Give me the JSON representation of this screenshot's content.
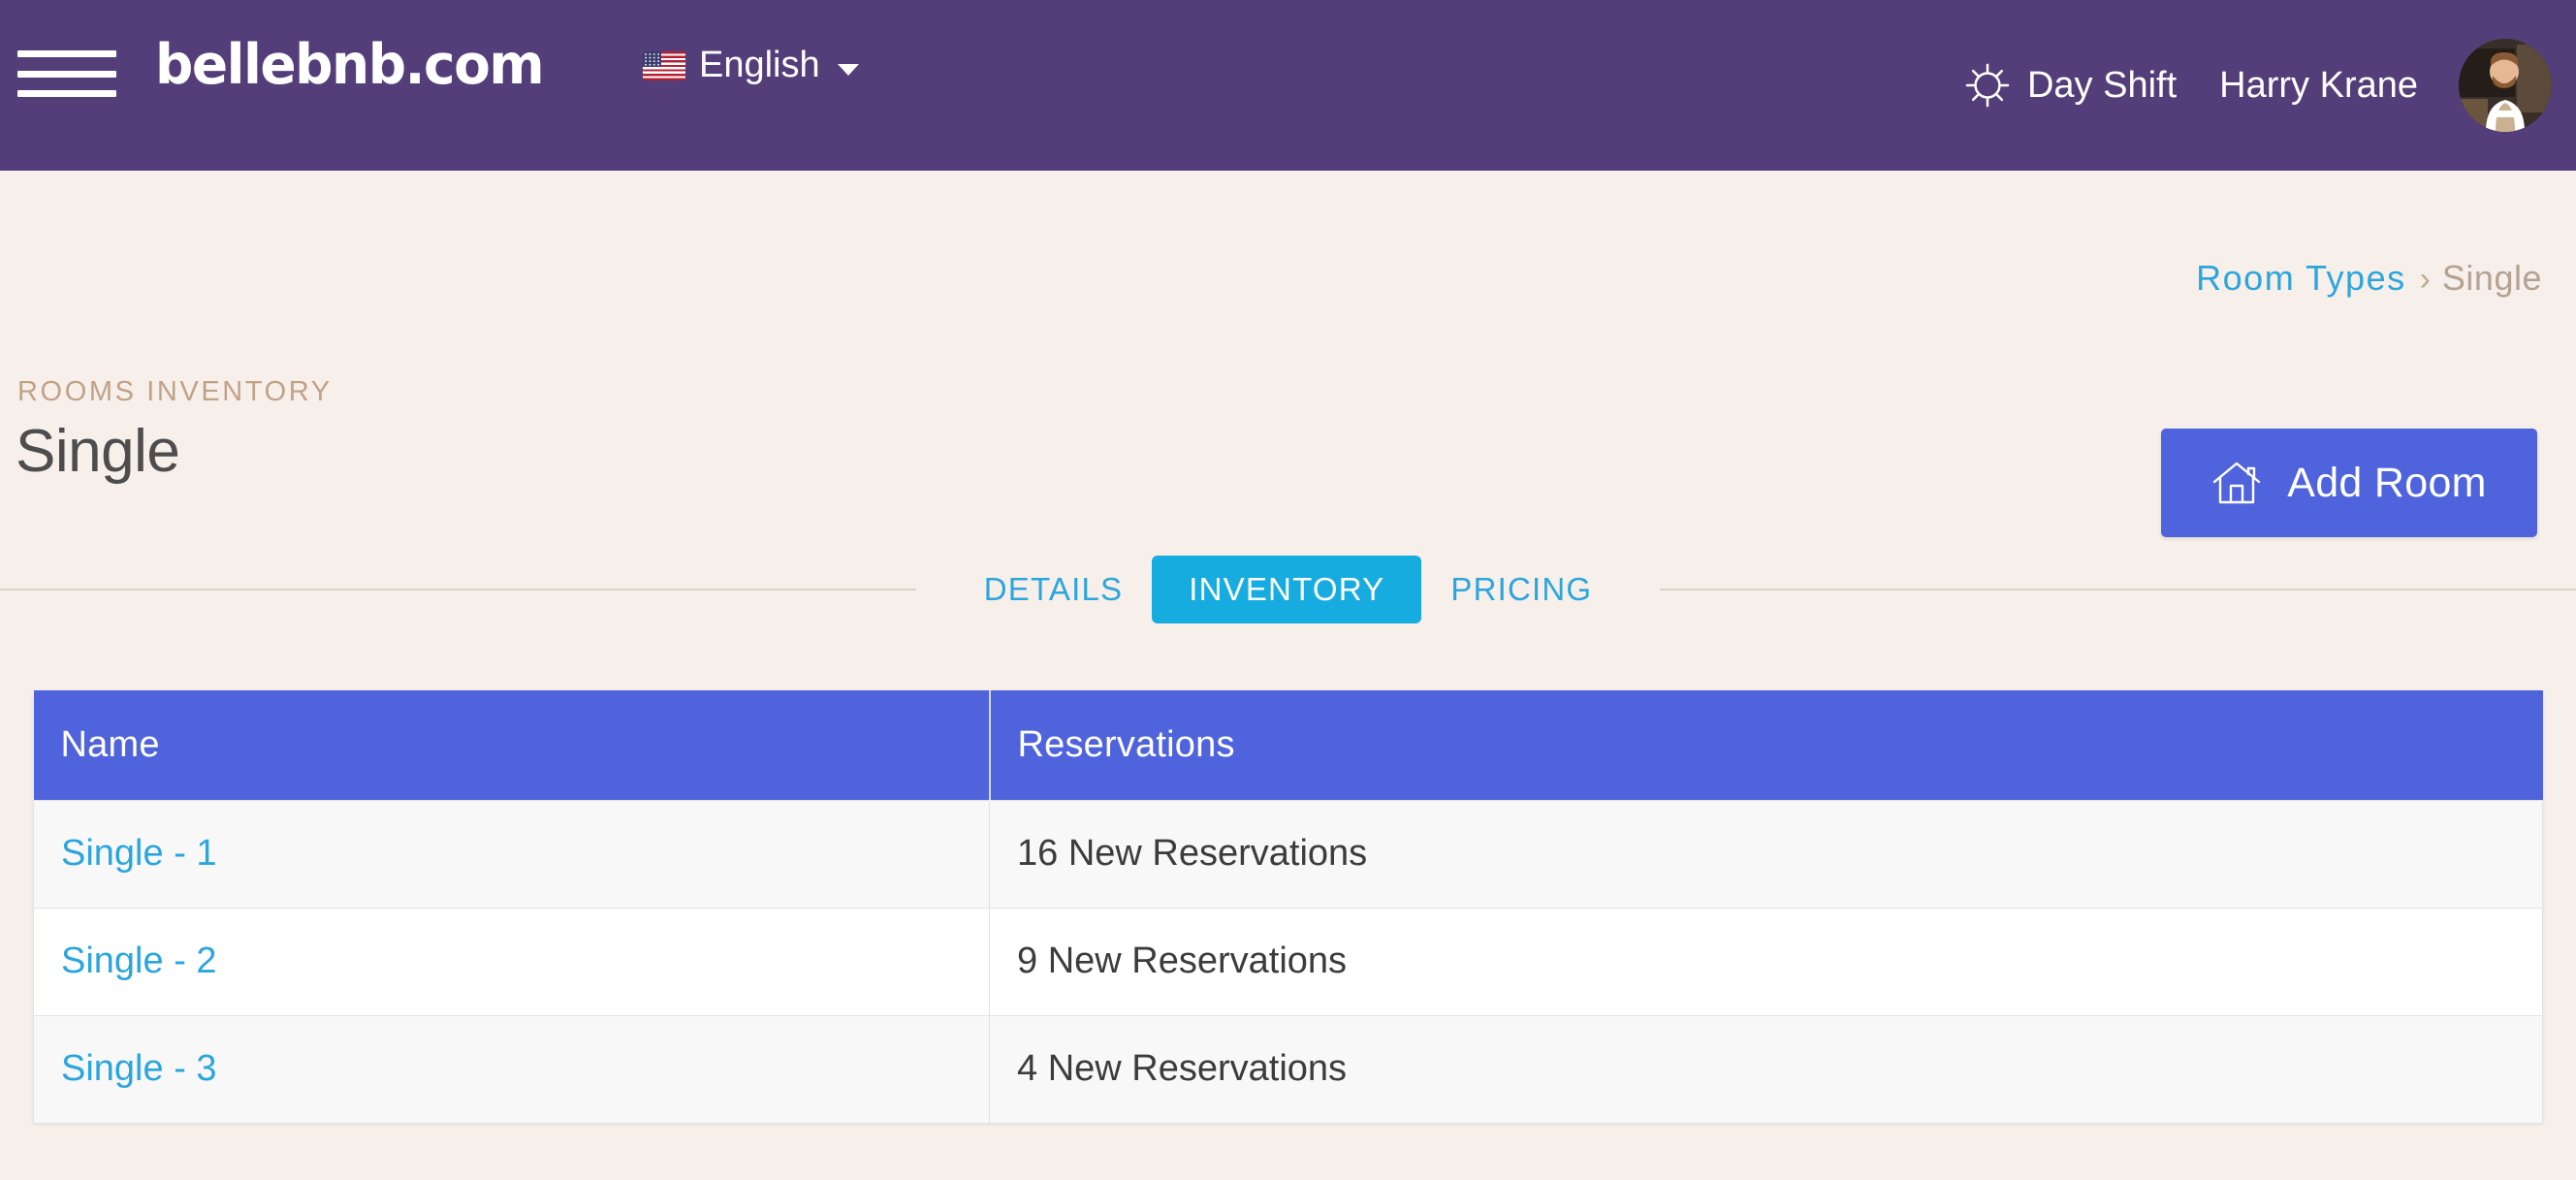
{
  "header": {
    "menu_icon": "hamburger-icon",
    "brand": "bellebnb.com",
    "language": {
      "flag_icon": "us-flag-icon",
      "label": "English",
      "caret_icon": "chevron-down-icon"
    },
    "shift": {
      "icon": "sun-icon",
      "label": "Day Shift"
    },
    "user_name": "Harry Krane",
    "avatar_icon": "user-avatar-photo",
    "background_color": "#543e79"
  },
  "breadcrumb": {
    "parent": "Room Types",
    "separator": "›",
    "current": "Single"
  },
  "page": {
    "eyebrow": "ROOMS INVENTORY",
    "title": "Single",
    "background_color": "#f7efe9"
  },
  "actions": {
    "add_room": {
      "icon": "home-icon",
      "label": "Add Room",
      "color": "#4f63dd"
    }
  },
  "tabs": {
    "items": [
      {
        "label": "DETAILS",
        "active": false
      },
      {
        "label": "INVENTORY",
        "active": true
      },
      {
        "label": "PRICING",
        "active": false
      }
    ],
    "active_color": "#17acdf",
    "link_color": "#2ba6dd"
  },
  "table": {
    "columns": [
      "Name",
      "Reservations"
    ],
    "header_color": "#4f63dd",
    "rows": [
      {
        "name": "Single - 1",
        "reservations": "16 New Reservations"
      },
      {
        "name": "Single - 2",
        "reservations": "9 New Reservations"
      },
      {
        "name": "Single - 3",
        "reservations": "4 New Reservations"
      }
    ]
  }
}
